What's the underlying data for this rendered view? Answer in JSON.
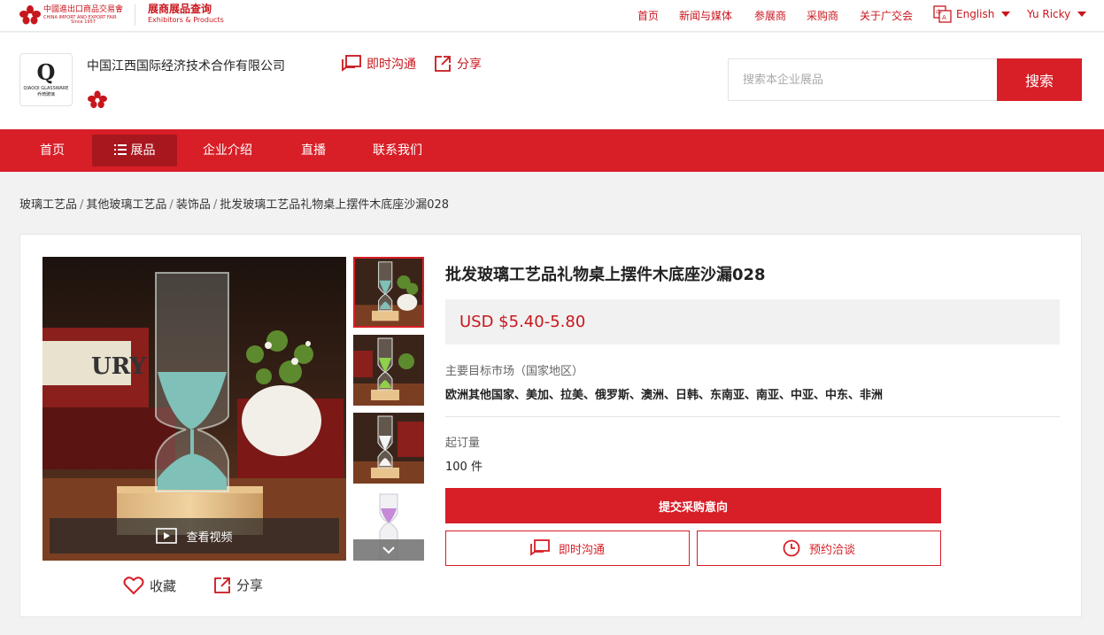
{
  "colors": {
    "brand_red": "#d81e27",
    "nav_active": "#a8161e",
    "price_bg": "#f1f1f1",
    "page_bg": "#f2f2f2"
  },
  "fair_logo": {
    "cn": "中國進出口商品交易會",
    "en": "CHINA IMPORT AND EXPORT FAIR",
    "since": "Since 1957"
  },
  "site_logo": {
    "title": "展商展品查询",
    "subtitle": "Exhibitors & Products"
  },
  "top_nav": [
    "首页",
    "新闻与媒体",
    "参展商",
    "采购商",
    "关于广交会"
  ],
  "language": {
    "label": "English",
    "icon": "language-icon"
  },
  "user": {
    "name": "Yu Ricky"
  },
  "company": {
    "logo_mark": "Q",
    "logo_text": "QIAOQI GLASSWARE",
    "logo_text_cn": "乔琦玻璃",
    "name": "中国江西国际经济技术合作有限公司",
    "chat_label": "即时沟通",
    "share_label": "分享"
  },
  "search": {
    "placeholder": "搜索本企业展品",
    "button": "搜索"
  },
  "main_nav": [
    {
      "label": "首页"
    },
    {
      "label": "展品",
      "active": true,
      "icon": "list-icon"
    },
    {
      "label": "企业介绍"
    },
    {
      "label": "直播"
    },
    {
      "label": "联系我们"
    }
  ],
  "breadcrumb": [
    "玻璃工艺品",
    "其他玻璃工艺品",
    "装饰品",
    "批发玻璃工艺品礼物桌上摆件木底座沙漏028"
  ],
  "product": {
    "title": "批发玻璃工艺品礼物桌上摆件木底座沙漏028",
    "price": "USD $5.40-5.80",
    "market_label": "主要目标市场（国家地区）",
    "market_value": "欧洲其他国家、美加、拉美、俄罗斯、澳洲、日韩、东南亚、南亚、中亚、中东、非洲",
    "moq_label": "起订量",
    "moq_value": "100 件",
    "video_label": "查看视频",
    "favorite_label": "收藏",
    "share_label": "分享",
    "submit_label": "提交采购意向",
    "chat_label": "即时沟通",
    "appointment_label": "预约洽谈",
    "thumbnails": [
      "sand-blue",
      "sand-green",
      "sand-white",
      "sand-purple"
    ]
  }
}
